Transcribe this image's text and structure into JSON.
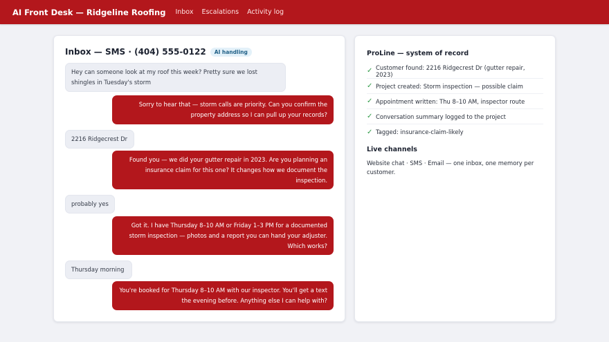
{
  "app": {
    "brand": "AI Front Desk — Ridgeline Roofing",
    "nav": [
      "Inbox",
      "Escalations",
      "Activity log"
    ]
  },
  "inbox": {
    "title": "Inbox — SMS · (404) 555-0122",
    "badge": "AI handling",
    "messages": [
      {
        "from": "customer",
        "text": "Hey can someone look at my roof this week? Pretty sure we lost shingles in Tuesday's storm"
      },
      {
        "from": "ai",
        "text": "Sorry to hear that — storm calls are priority. Can you confirm the property address so I can pull up your records?"
      },
      {
        "from": "customer",
        "text": "2216 Ridgecrest Dr"
      },
      {
        "from": "ai",
        "text": "Found you — we did your gutter repair in 2023. Are you planning an insurance claim for this one? It changes how we document the inspection."
      },
      {
        "from": "customer",
        "text": "probably yes"
      },
      {
        "from": "ai",
        "text": "Got it. I have Thursday 8–10 AM or Friday 1–3 PM for a documented storm inspection — photos and a report you can hand your adjuster. Which works?"
      },
      {
        "from": "customer",
        "text": "Thursday morning"
      },
      {
        "from": "ai",
        "text": "You're booked for Thursday 8–10 AM with our inspector. You'll get a text the evening before. Anything else I can help with?"
      }
    ]
  },
  "system": {
    "title": "ProLine — system of record",
    "items": [
      "Customer found: 2216 Ridgecrest Dr (gutter repair, 2023)",
      "Project created: Storm inspection — possible claim",
      "Appointment written: Thu 8–10 AM, inspector route",
      "Conversation summary logged to the project",
      "Tagged: insurance-claim-likely"
    ],
    "check_glyph": "✓",
    "channels_title": "Live channels",
    "channels_text": "Website chat · SMS · Email — one inbox, one memory per customer."
  },
  "colors": {
    "brand_red": "#b3171c",
    "page_bg": "#f1f2f6",
    "customer_bubble": "#eceef4",
    "check_green": "#2f9a46",
    "badge_bg": "#e3f1f9"
  }
}
